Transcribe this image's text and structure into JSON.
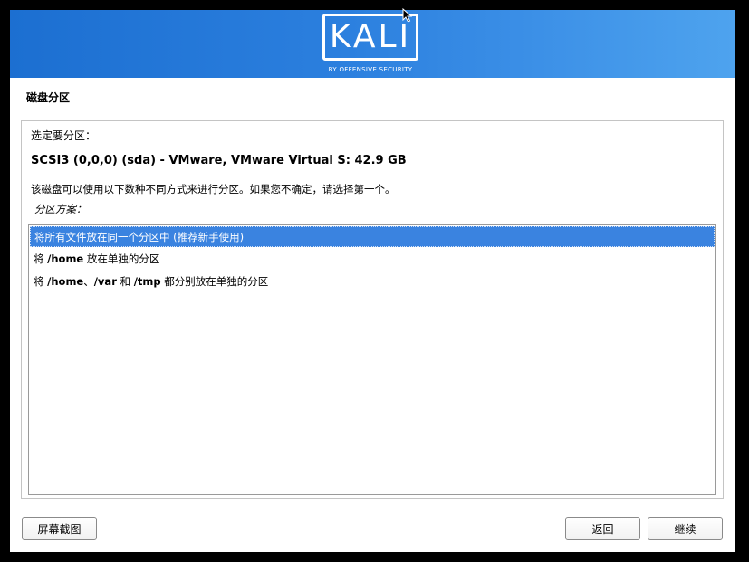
{
  "banner": {
    "logo_text": "KALI",
    "logo_subtext": "BY OFFENSIVE SECURITY",
    "gradient_start": "#1c6fd1",
    "gradient_end": "#4ea3ee"
  },
  "page": {
    "title": "磁盘分区",
    "prompt": "选定要分区：",
    "disk": "SCSI3 (0,0,0) (sda) - VMware, VMware Virtual S: 42.9 GB",
    "description": "该磁盘可以使用以下数种不同方式来进行分区。如果您不确定，请选择第一个。",
    "list_label": "分区方案："
  },
  "options": [
    {
      "parts": [
        "将所有文件放在同一个分区中 (推荐新手使用)"
      ],
      "selected": true
    },
    {
      "parts": [
        "将 ",
        "/home",
        " 放在单独的分区"
      ],
      "selected": false
    },
    {
      "parts": [
        "将 ",
        "/home",
        "、",
        "/var",
        " 和 ",
        "/tmp",
        " 都分别放在单独的分区"
      ],
      "selected": false
    }
  ],
  "buttons": {
    "screenshot": "屏幕截图",
    "back": "返回",
    "continue": "继续"
  },
  "colors": {
    "selection": "#3a83e0",
    "window_bg": "#ffffff",
    "frame_bg": "#000000"
  }
}
